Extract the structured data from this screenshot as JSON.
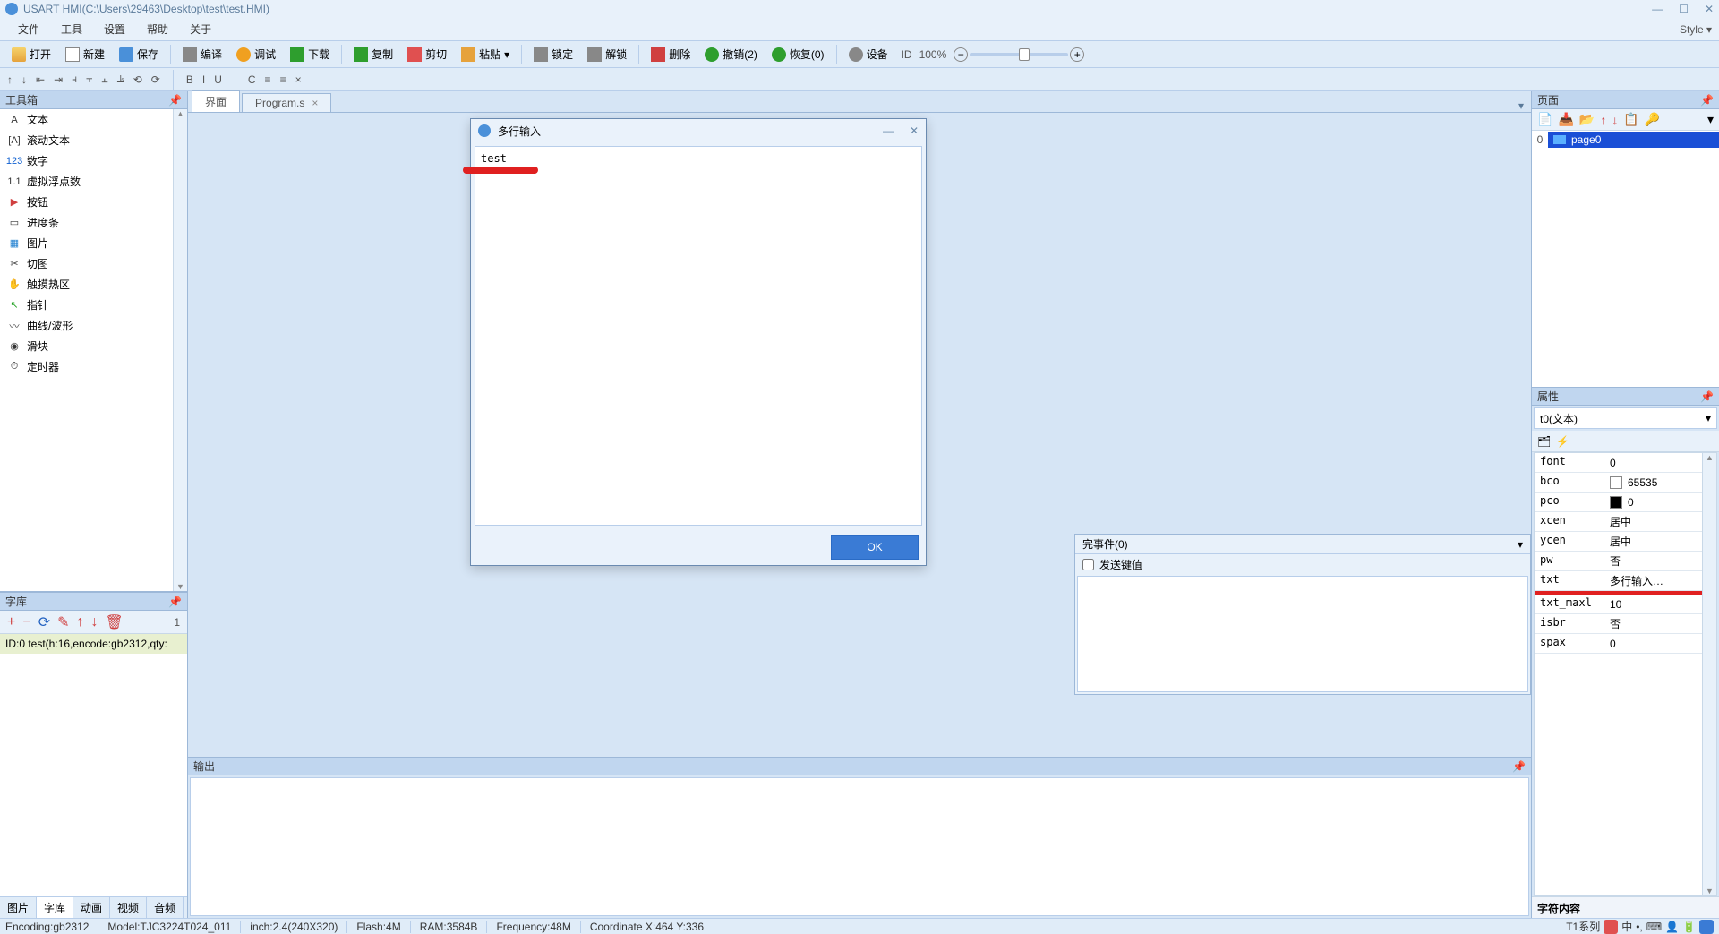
{
  "title": "USART HMI(C:\\Users\\29463\\Desktop\\test\\test.HMI)",
  "menubar": {
    "items": [
      "文件",
      "工具",
      "设置",
      "帮助",
      "关于"
    ],
    "style": "Style ▾"
  },
  "toolbar": {
    "open": "打开",
    "new": "新建",
    "save": "保存",
    "compile": "编译",
    "debug": "调试",
    "download": "下载",
    "copy": "复制",
    "cut": "剪切",
    "paste": "粘贴",
    "lock": "锁定",
    "unlock": "解锁",
    "delete": "删除",
    "undo": "撤销(2)",
    "redo": "恢复(0)",
    "device": "设备",
    "id": "ID",
    "zoom": "100%"
  },
  "toolbar2": {
    "items": [
      "↑",
      "↓",
      "⇤",
      "⇥",
      "⫞",
      "⫟",
      "⫠",
      "⫡",
      "⟲",
      "⟳",
      "B",
      "I",
      "U",
      "C",
      "≡",
      "≡",
      "×"
    ]
  },
  "toolbox": {
    "title": "工具箱",
    "items": [
      {
        "icon": "A",
        "label": "文本"
      },
      {
        "icon": "[A]",
        "label": "滚动文本"
      },
      {
        "icon": "123",
        "label": "数字",
        "color": "#1060d0"
      },
      {
        "icon": "1.1",
        "label": "虚拟浮点数"
      },
      {
        "icon": "▶",
        "label": "按钮",
        "color": "#d04040"
      },
      {
        "icon": "▭",
        "label": "进度条"
      },
      {
        "icon": "▦",
        "label": "图片",
        "color": "#2080d0"
      },
      {
        "icon": "✂",
        "label": "切图"
      },
      {
        "icon": "✋",
        "label": "触摸热区"
      },
      {
        "icon": "↖",
        "label": "指针",
        "color": "#20a020"
      },
      {
        "icon": "〰",
        "label": "曲线/波形"
      },
      {
        "icon": "◉",
        "label": "滑块"
      },
      {
        "icon": "⏱",
        "label": "定时器"
      }
    ]
  },
  "font": {
    "title": "字库",
    "index": "1",
    "row": "ID:0  test(h:16,encode:gb2312,qty:"
  },
  "leftTabs": {
    "items": [
      "图片",
      "字库",
      "动画",
      "视频",
      "音频"
    ],
    "active": 1
  },
  "tabs": {
    "items": [
      "界面",
      "Program.s"
    ],
    "active": 0
  },
  "output": {
    "title": "输出"
  },
  "events": {
    "title": "完事件(0)",
    "sendkey": "发送键值"
  },
  "pagePanel": {
    "title": "页面",
    "page": {
      "index": "0",
      "name": "page0"
    }
  },
  "prop": {
    "title": "属性",
    "selected": "t0(文本)",
    "rows": [
      {
        "k": "font",
        "v": "0"
      },
      {
        "k": "bco",
        "v": "65535",
        "swatch": "#ffffff"
      },
      {
        "k": "pco",
        "v": "0",
        "swatch": "#000000"
      },
      {
        "k": "xcen",
        "v": "居中"
      },
      {
        "k": "ycen",
        "v": "居中"
      },
      {
        "k": "pw",
        "v": "否"
      },
      {
        "k": "txt",
        "v": "多行输入…",
        "dd": true
      },
      {
        "k": "txt_maxl",
        "v": "10"
      },
      {
        "k": "isbr",
        "v": "否"
      },
      {
        "k": "spax",
        "v": "0"
      }
    ],
    "desc": "字符内容"
  },
  "statusbar": {
    "encoding": "Encoding:gb2312",
    "model": "Model:TJC3224T024_011",
    "inch": "inch:2.4(240X320)",
    "flash": "Flash:4M",
    "ram": "RAM:3584B",
    "freq": "Frequency:48M",
    "coord": "Coordinate X:464  Y:336",
    "series": "T1系列"
  },
  "modal": {
    "title": "多行输入",
    "value": "test",
    "ok": "OK"
  }
}
